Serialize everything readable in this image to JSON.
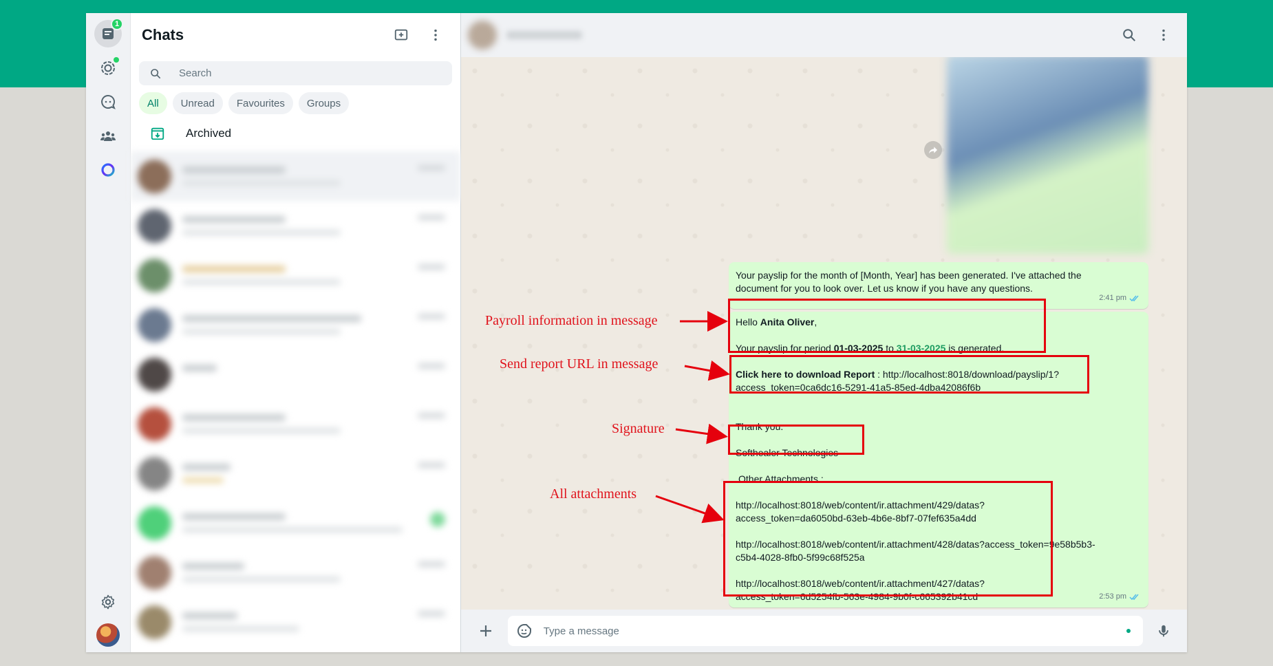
{
  "sidebar": {
    "title": "Chats",
    "unread_badge": "1",
    "search_placeholder": "Search",
    "filters": [
      {
        "label": "All"
      },
      {
        "label": "Unread"
      },
      {
        "label": "Favourites"
      },
      {
        "label": "Groups"
      }
    ],
    "archived_label": "Archived"
  },
  "conversation": {
    "message1": {
      "line1": "Your payslip for the month of [Month, Year] has been generated. I've attached the",
      "line2": "document for you to look over. Let us know if you have any questions.",
      "time": "2:41 pm"
    },
    "message2": {
      "hello": "Hello ",
      "name": "Anita Oliver",
      "comma": ",",
      "period_prefix": "Your payslip for period ",
      "period_from": "01-03-2025",
      "period_to_word": " to ",
      "period_to": "31-03-2025",
      "period_suffix": " is generated.",
      "download_label": "Click here to download Report",
      "download_url_1": " : http://localhost:8018/download/payslip/1?",
      "download_url_2": "access_token=0ca6dc16-5291-41a5-85ed-4dba42086f6b",
      "thanks": "Thank you.",
      "signature": "Softhealer Technologies",
      "other_attachments": "Other Attachments :",
      "attachments": [
        {
          "line1": "http://localhost:8018/web/content/ir.attachment/429/datas?",
          "line2": "access_token=da6050bd-63eb-4b6e-8bf7-07fef635a4dd"
        },
        {
          "line1": "http://localhost:8018/web/content/ir.attachment/428/datas?access_token=9e58b5b3-",
          "line2": "c5b4-4028-8fb0-5f99c68f525a"
        },
        {
          "line1": "http://localhost:8018/web/content/ir.attachment/427/datas?",
          "line2": "access_token=6d5254fb-563e-4984-9b0f-c665392b41cd"
        }
      ],
      "time": "2:53 pm"
    }
  },
  "composer": {
    "placeholder": "Type a message"
  },
  "annotations": {
    "payroll": "Payroll information in message",
    "report_url": "Send report URL in message",
    "signature": "Signature",
    "attachments": "All attachments"
  },
  "colors": {
    "brand_band": "#00a884",
    "outgoing_bubble": "#d9fdd3",
    "annotation_red": "#e5000d"
  }
}
